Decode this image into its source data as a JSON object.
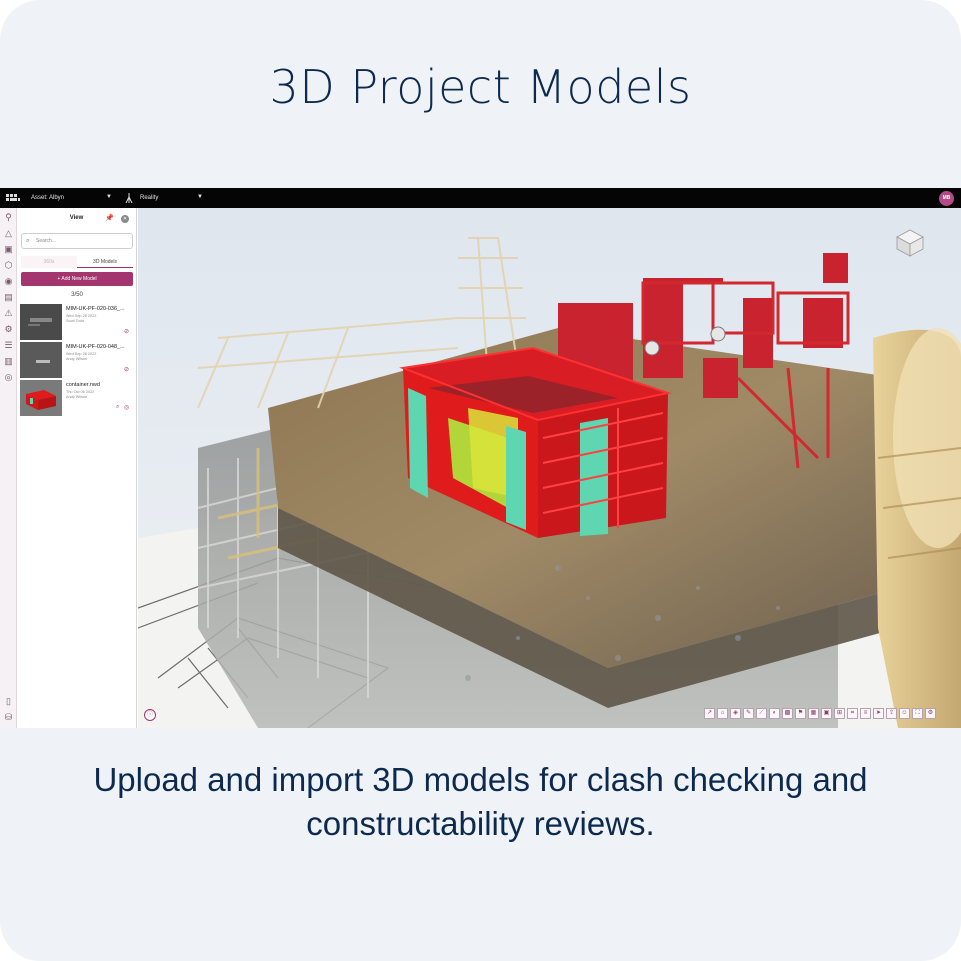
{
  "headline": "3D Project Models",
  "caption": "Upload and import 3D models for clash checking and constructability reviews.",
  "app": {
    "topbar": {
      "asset_label": "Asset: Albyn",
      "reality_label": "Reality",
      "avatar_initials": "MB"
    },
    "panel": {
      "title": "View",
      "search_placeholder": "Search...",
      "tabs": [
        "360s",
        "3D Models"
      ],
      "add_button": "+ Add New Model",
      "count": "3/50",
      "models": [
        {
          "name": "MIM-UK-PF-020-036_...",
          "date": "Wed Sep 28 2022",
          "author": "Scott Todd"
        },
        {
          "name": "MIM-UK-PF-020-048_...",
          "date": "Wed Sep 28 2022",
          "author": "Andy Wilson"
        },
        {
          "name": "container.nwd",
          "date": "Thu Oct 06 2022",
          "author": "Andy Wilson"
        }
      ]
    },
    "colors": {
      "accent": "#a3366f",
      "container_red": "#e01b1b",
      "panel_green": "#5fd6b2"
    }
  }
}
